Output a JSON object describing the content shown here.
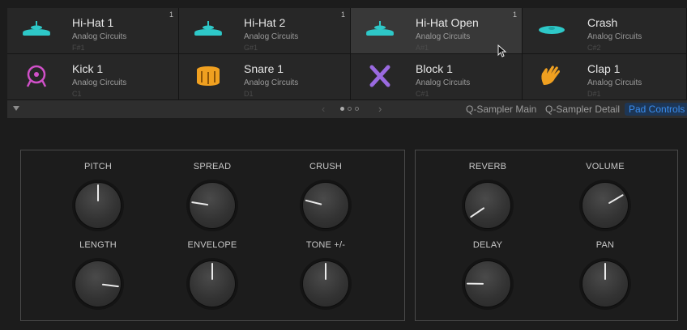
{
  "pads": [
    {
      "name": "Hi-Hat 1",
      "kit": "Analog Circuits",
      "note": "F#1",
      "badge": "1",
      "icon": "hihat-icon",
      "color": "#2ec8c8"
    },
    {
      "name": "Hi-Hat 2",
      "kit": "Analog Circuits",
      "note": "G#1",
      "badge": "1",
      "icon": "hihat-icon",
      "color": "#2ec8c8"
    },
    {
      "name": "Hi-Hat Open",
      "kit": "Analog Circuits",
      "note": "A#1",
      "badge": "1",
      "icon": "hihat-icon",
      "color": "#2ec8c8"
    },
    {
      "name": "Crash",
      "kit": "Analog Circuits",
      "note": "C#2",
      "badge": "",
      "icon": "cymbal-icon",
      "color": "#2ec8c8"
    },
    {
      "name": "Kick 1",
      "kit": "Analog Circuits",
      "note": "C1",
      "badge": "",
      "icon": "kick-drum-icon",
      "color": "#d050c8"
    },
    {
      "name": "Snare 1",
      "kit": "Analog Circuits",
      "note": "D1",
      "badge": "",
      "icon": "snare-drum-icon",
      "color": "#f0a020"
    },
    {
      "name": "Block 1",
      "kit": "Analog Circuits",
      "note": "C#1",
      "badge": "",
      "icon": "sticks-icon",
      "color": "#9a6ae0"
    },
    {
      "name": "Clap 1",
      "kit": "Analog Circuits",
      "note": "D#1",
      "badge": "",
      "icon": "clap-hand-icon",
      "color": "#f0a020"
    }
  ],
  "tabbar": {
    "prev": "‹",
    "next": "›",
    "tabs": [
      "Q-Sampler Main",
      "Q-Sampler Detail",
      "Pad Controls"
    ],
    "active_tab": "Pad Controls"
  },
  "colors": {
    "accent": "#3a8ef0",
    "background": "#1c1c1c"
  },
  "knobs": [
    {
      "label": "PITCH",
      "value": 0.5
    },
    {
      "label": "SPREAD",
      "value": 0.2
    },
    {
      "label": "CRUSH",
      "value": 0.22
    },
    {
      "label": "REVERB",
      "value": 0.04
    },
    {
      "label": "VOLUME",
      "value": 0.72
    },
    {
      "label": "LENGTH",
      "value": 0.86
    },
    {
      "label": "ENVELOPE",
      "value": 0.5
    },
    {
      "label": "TONE +/-",
      "value": 0.5
    },
    {
      "label": "DELAY",
      "value": 0.17
    },
    {
      "label": "PAN",
      "value": 0.5
    }
  ]
}
